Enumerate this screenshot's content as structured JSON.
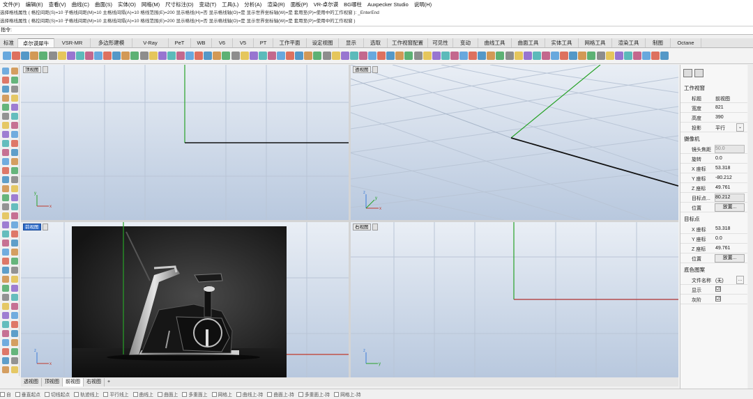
{
  "menu": [
    "文件(F)",
    "编辑(E)",
    "查看(V)",
    "曲线(C)",
    "曲面(S)",
    "实体(O)",
    "网格(M)",
    "尺寸标注(D)",
    "变动(T)",
    "工具(L)",
    "分析(A)",
    "渲染(R)",
    "面板(P)",
    "VR-卓尔谟",
    "BG哪柱",
    "Auxpecker Studio",
    "说明(H)"
  ],
  "history": [
    "选择格线属性 ( 格控间距(S)=10  子格线间距(M)=10  主格线间隔(A)=10  格线范围(E)=200  显示格线(H)=否  显示格线轴(O)=是  显示世界坐标轴(W)=是  套用至(P)=使用中的工作视窗 ): _EnterEnd",
    "选择格线属性 ( 格控间距(S)=10  子格线间距(M)=10  主格线间隔(A)=10  格线范围(E)=200  显示格线(H)=否  显示格线轴(O)=是  显示世界坐标轴(W)=是  套用至(P)=使用中的工作视窗 )"
  ],
  "command_prompt": "指令:",
  "tabs": [
    "标准",
    "卓尔谟犀牛",
    "VSR-MR",
    "多边形建模",
    "V-Ray",
    "PeT",
    "WB",
    "V6",
    "V5",
    "PT",
    "工作平面",
    "设定视图",
    "显示",
    "选取",
    "工作视窗配置",
    "可见性",
    "变动",
    "曲线工具",
    "曲面工具",
    "实体工具",
    "网格工具",
    "渲染工具",
    "制图",
    "Octane"
  ],
  "active_tab": "卓尔谟犀牛",
  "viewports": {
    "top": "顶视图",
    "perspective": "透视图",
    "front": "前视图",
    "right": "右视图"
  },
  "viewport_tabs": [
    "透视图",
    "顶视图",
    "前视图",
    "右视图",
    "+"
  ],
  "active_viewport_tab": "前视图",
  "osnaps": [
    "自",
    "垂直起点",
    "切线起点",
    "轨迹线上",
    "平行线上",
    "曲线上",
    "曲面上",
    "多重面上",
    "网格上",
    "曲线上-持",
    "曲面上-持",
    "多重面上-持",
    "网格上-持"
  ],
  "properties": {
    "section_viewport": "工作视窗",
    "rows_viewport": [
      {
        "label": "标题",
        "value": "前视图"
      },
      {
        "label": "宽度",
        "value": "821"
      },
      {
        "label": "高度",
        "value": "390"
      },
      {
        "label": "投影",
        "value": "平行"
      }
    ],
    "section_camera": "摄像机",
    "rows_camera": [
      {
        "label": "镜头焦距",
        "value": "50.0"
      },
      {
        "label": "旋转",
        "value": "0.0"
      },
      {
        "label": "X 座标",
        "value": "53.318"
      },
      {
        "label": "Y 座标",
        "value": "-80.212"
      },
      {
        "label": "Z 座标",
        "value": "49.761"
      },
      {
        "label": "目标点...",
        "value": "80.212"
      },
      {
        "label": "位置",
        "value": "放置..."
      }
    ],
    "section_target": "目标点",
    "rows_target": [
      {
        "label": "X 座标",
        "value": "53.318"
      },
      {
        "label": "Y 座标",
        "value": "0.0"
      },
      {
        "label": "Z 座标",
        "value": "49.761"
      },
      {
        "label": "位置",
        "value": "放置..."
      }
    ],
    "section_wallpaper": "底色图案",
    "rows_wallpaper": [
      {
        "label": "文件名称",
        "value": "(无)"
      },
      {
        "label": "显示",
        "value": "☑"
      },
      {
        "label": "灰阶",
        "value": "☑"
      }
    ]
  },
  "colors": {
    "axis_x": "#c0392b",
    "axis_y": "#27a227",
    "grid_line": "#b6c2d2",
    "viewport_top": "#e9eef5",
    "viewport_bottom": "#b8c8de",
    "active_label": "#2b6ac9"
  }
}
